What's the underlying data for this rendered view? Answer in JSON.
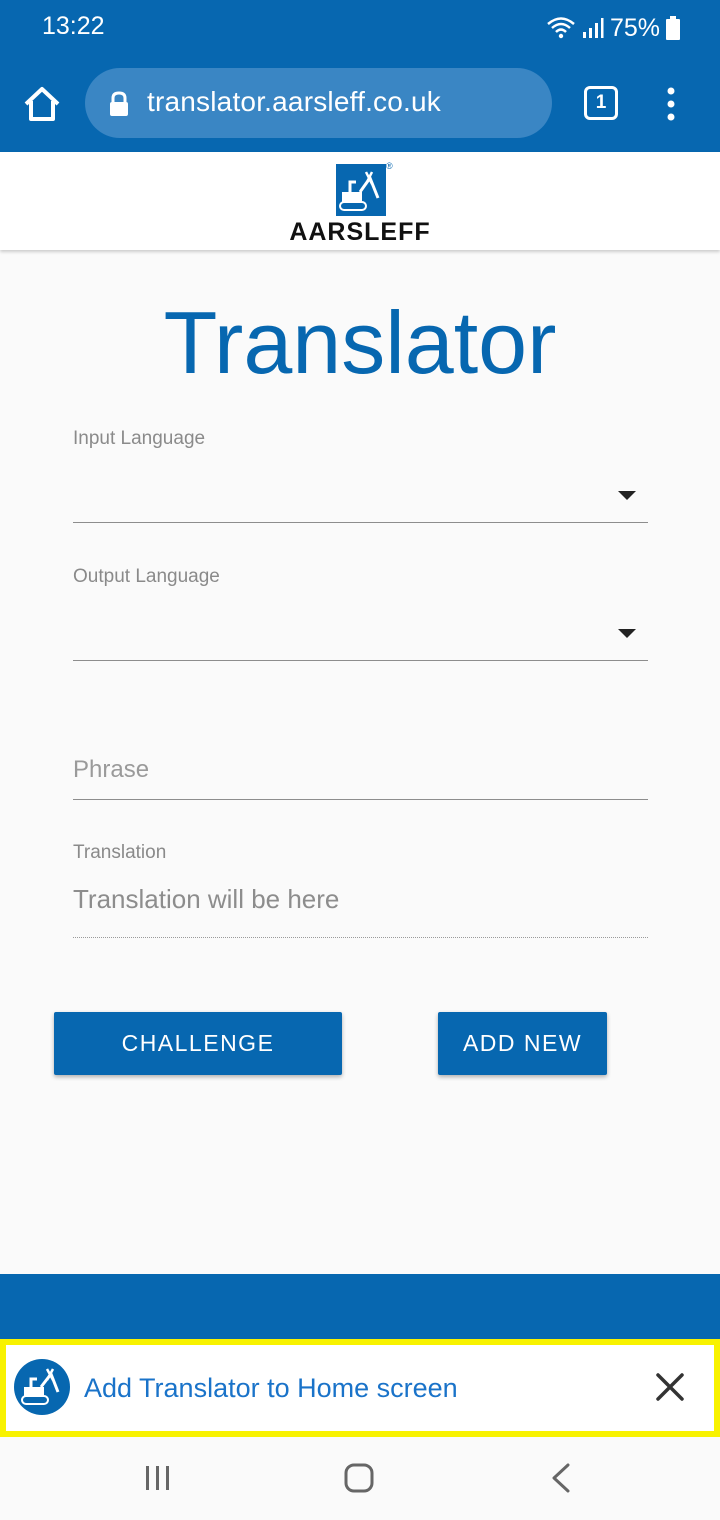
{
  "status_bar": {
    "time": "13:22",
    "battery": "75%"
  },
  "browser": {
    "url": "translator.aarsleff.co.uk",
    "tab_count": "1"
  },
  "header": {
    "logo_text": "AARSLEFF",
    "registered_mark": "®"
  },
  "form": {
    "title": "Translator",
    "input_language_label": "Input Language",
    "output_language_label": "Output Language",
    "phrase_placeholder": "Phrase",
    "translation_label": "Translation",
    "translation_value": "Translation will be here"
  },
  "buttons": {
    "challenge": "CHALLENGE",
    "add_new": "ADD NEW"
  },
  "install_banner": {
    "text": "Add Translator to Home screen"
  },
  "colors": {
    "brand": "#0767b0",
    "highlight": "#f8f200",
    "link": "#1a73c9"
  }
}
